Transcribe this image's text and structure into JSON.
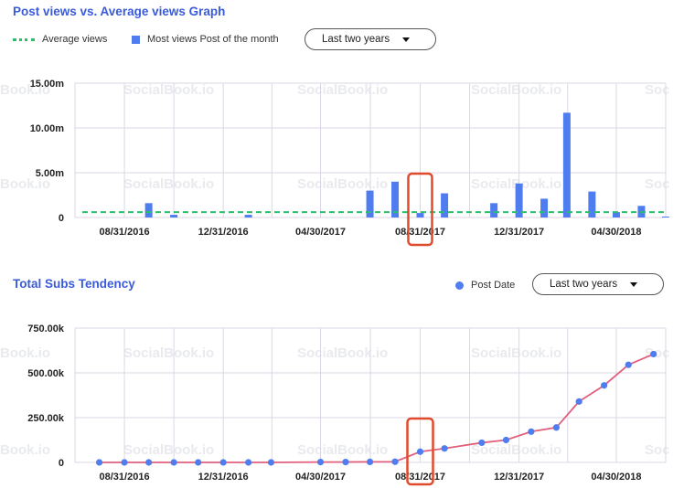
{
  "watermark_text": [
    "SocialBook.io",
    "Book.io",
    "Soc"
  ],
  "colors": {
    "title": "#3a5bd9",
    "bar": "#4f7df0",
    "average_line": "#2bbf6b",
    "line": "#e0607e",
    "point": "#4f7df0",
    "highlight": "#e04b2e",
    "grid": "#ddd6e6"
  },
  "chart_data": [
    {
      "type": "bar",
      "title": "Post views vs. Average views Graph",
      "legend": {
        "position": "top-left",
        "entries": [
          {
            "label": "Average views",
            "style": "dashed-line"
          },
          {
            "label": "Most views Post of the month",
            "style": "bar"
          }
        ]
      },
      "dropdown": {
        "selected": "Last two years"
      },
      "y_ticks": [
        "15.00m",
        "10.00m",
        "5.00m",
        "0"
      ],
      "ylim": [
        0,
        15
      ],
      "y_unit": "m",
      "x_ticks": [
        "08/31/2016",
        "12/31/2016",
        "04/30/2017",
        "08/31/2017",
        "12/31/2017",
        "04/30/2018"
      ],
      "x_range": [
        "2016-07-01",
        "2018-06-30"
      ],
      "series": [
        {
          "name": "Most views Post of the month",
          "points": [
            {
              "x": "2016-09-30",
              "y": 1.6
            },
            {
              "x": "2016-10-31",
              "y": 0.3
            },
            {
              "x": "2017-01-31",
              "y": 0.3
            },
            {
              "x": "2017-06-30",
              "y": 3.0
            },
            {
              "x": "2017-07-31",
              "y": 4.0
            },
            {
              "x": "2017-08-31",
              "y": 0.5
            },
            {
              "x": "2017-09-30",
              "y": 2.7
            },
            {
              "x": "2017-11-30",
              "y": 1.6
            },
            {
              "x": "2017-12-31",
              "y": 3.8
            },
            {
              "x": "2018-01-31",
              "y": 2.1
            },
            {
              "x": "2018-02-28",
              "y": 11.7
            },
            {
              "x": "2018-03-31",
              "y": 2.9
            },
            {
              "x": "2018-04-30",
              "y": 0.6
            },
            {
              "x": "2018-05-31",
              "y": 1.3
            },
            {
              "x": "2018-06-30",
              "y": 0.1
            }
          ]
        },
        {
          "name": "Average views",
          "constant_y": 0.6
        }
      ],
      "grid": true,
      "highlight_x": "2017-08-31"
    },
    {
      "type": "line",
      "title": "Total Subs Tendency",
      "legend": {
        "position": "top-right",
        "entries": [
          {
            "label": "Post Date",
            "style": "dot"
          }
        ]
      },
      "dropdown": {
        "selected": "Last two years"
      },
      "y_ticks": [
        "750.00k",
        "500.00k",
        "250.00k",
        "0"
      ],
      "ylim": [
        0,
        750
      ],
      "y_unit": "k",
      "x_ticks": [
        "08/31/2016",
        "12/31/2016",
        "04/30/2017",
        "08/31/2017",
        "12/31/2017",
        "04/30/2018"
      ],
      "x_range": [
        "2016-07-01",
        "2018-06-30"
      ],
      "series": [
        {
          "name": "Post Date",
          "points": [
            {
              "x": "2016-07-31",
              "y": 0
            },
            {
              "x": "2016-08-31",
              "y": 0
            },
            {
              "x": "2016-09-30",
              "y": 0
            },
            {
              "x": "2016-10-31",
              "y": 0
            },
            {
              "x": "2016-11-30",
              "y": 0
            },
            {
              "x": "2016-12-31",
              "y": 0
            },
            {
              "x": "2017-01-31",
              "y": 0
            },
            {
              "x": "2017-02-28",
              "y": 0
            },
            {
              "x": "2017-04-30",
              "y": 2
            },
            {
              "x": "2017-05-31",
              "y": 2
            },
            {
              "x": "2017-06-30",
              "y": 3
            },
            {
              "x": "2017-07-31",
              "y": 4
            },
            {
              "x": "2017-08-31",
              "y": 60
            },
            {
              "x": "2017-09-30",
              "y": 78
            },
            {
              "x": "2017-11-15",
              "y": 110
            },
            {
              "x": "2017-12-15",
              "y": 125
            },
            {
              "x": "2018-01-15",
              "y": 172
            },
            {
              "x": "2018-02-15",
              "y": 195
            },
            {
              "x": "2018-03-15",
              "y": 340
            },
            {
              "x": "2018-04-15",
              "y": 430
            },
            {
              "x": "2018-05-15",
              "y": 545
            },
            {
              "x": "2018-06-15",
              "y": 605
            }
          ]
        }
      ],
      "grid": true,
      "highlight_x": "2017-08-31"
    }
  ]
}
